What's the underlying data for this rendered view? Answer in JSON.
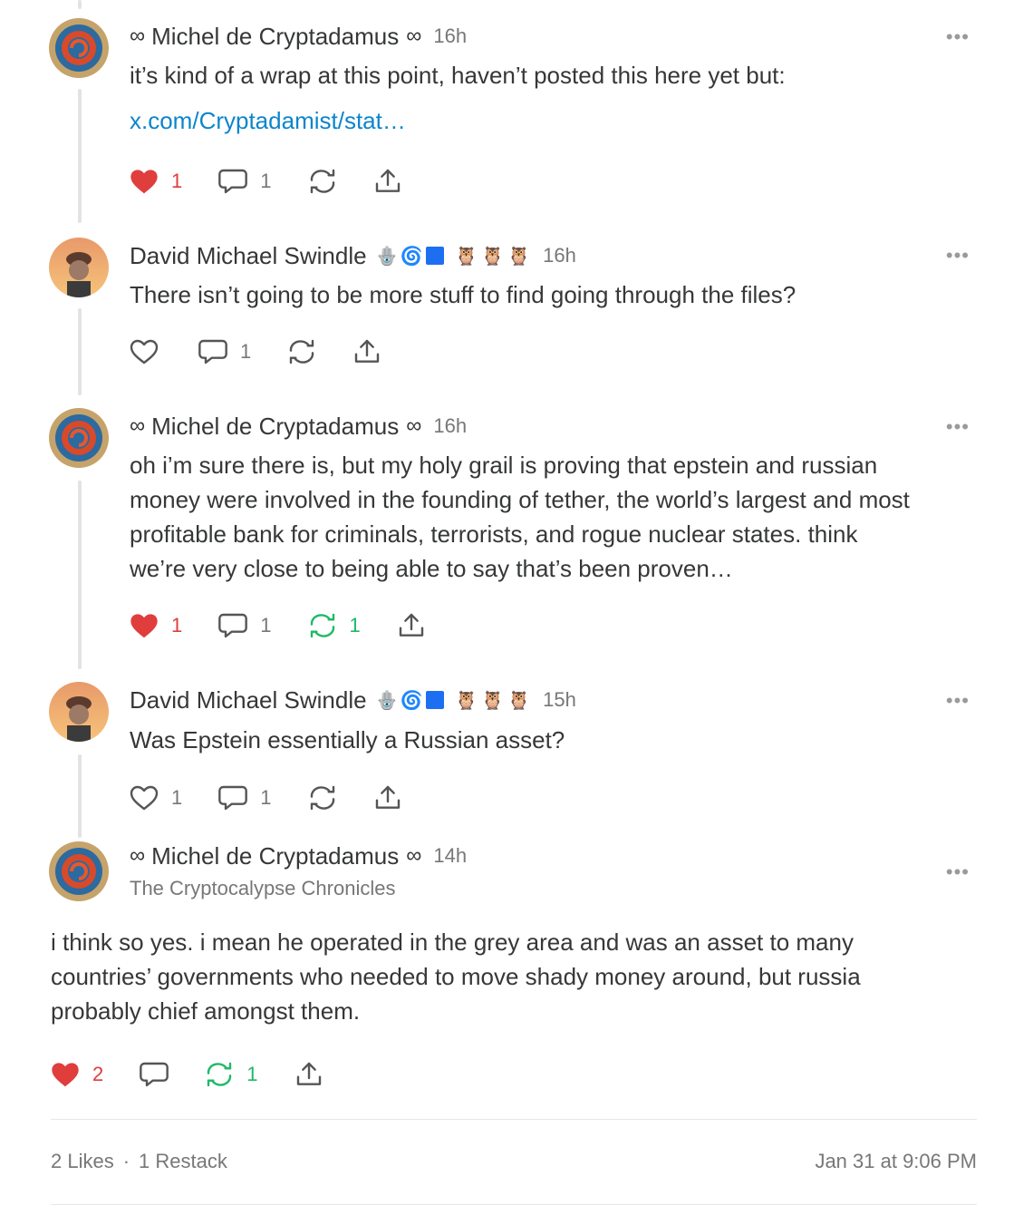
{
  "posts": [
    {
      "author": "Michel de Cryptadamus",
      "infinity": "∞",
      "time": "16h",
      "text": "it’s kind of a wrap at this point, haven’t posted this here yet but:",
      "link": "x.com/Cryptadamist/stat…",
      "likes": "1",
      "comments": "1",
      "restacks": ""
    },
    {
      "author": "David Michael Swindle",
      "time": "16h",
      "text": "There isn’t going to be more stuff to find going through the files?",
      "likes": "",
      "comments": "1",
      "restacks": ""
    },
    {
      "author": "Michel de Cryptadamus",
      "infinity": "∞",
      "time": "16h",
      "text_lines": [
        "oh i’m sure there is, but my holy grail is proving that epstein and russian",
        "money were involved in the founding of tether, the world’s largest and most",
        "profitable bank for criminals, terrorists, and rogue nuclear states. think",
        "we’re very close to being able to say that’s been proven…"
      ],
      "likes": "1",
      "comments": "1",
      "restacks": "1"
    },
    {
      "author": "David Michael Swindle",
      "time": "15h",
      "text": "Was Epstein essentially a Russian asset?",
      "likes": "1",
      "comments": "1",
      "restacks": ""
    },
    {
      "author": "Michel de Cryptadamus",
      "infinity": "∞",
      "time": "14h",
      "publication": "The Cryptocalypse Chronicles",
      "text_lines": [
        "i think so yes. i mean he operated in the grey area and was an asset to many",
        "countries’ governments who needed to move shady money around, but russia",
        "probably chief amongst them."
      ],
      "likes": "2",
      "comments": "",
      "restacks": "1"
    }
  ],
  "more_label": "•••",
  "badges": {
    "hamsa": "🪬",
    "spiral": "🌀",
    "owl": "🦉"
  },
  "footer": {
    "likes": "2 Likes",
    "separator": "·",
    "restacks": "1 Restack",
    "timestamp": "Jan 31 at 9:06 PM"
  },
  "colors": {
    "like_red": "#e03d3d",
    "restack_green": "#1fb967",
    "link_blue": "#0b85cc",
    "thread_line": "#e3e3e3"
  }
}
